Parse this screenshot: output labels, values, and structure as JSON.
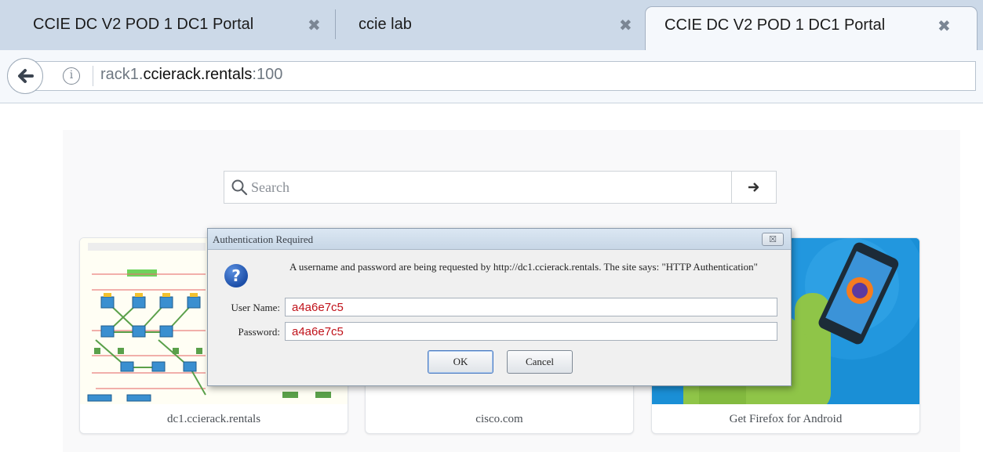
{
  "tabs": [
    {
      "label": "CCIE DC V2 POD 1 DC1 Portal",
      "close": "✖",
      "active": false
    },
    {
      "label": "ccie lab",
      "close": "✖",
      "active": false
    },
    {
      "label": "CCIE DC V2 POD 1 DC1 Portal",
      "close": "✖",
      "active": true
    }
  ],
  "navbar": {
    "back_icon": "arrow-left-icon",
    "info_icon": "info-icon",
    "info_glyph": "i",
    "url": {
      "subdomain": "rack1.",
      "host": "ccierack.rentals",
      "port": ":100"
    }
  },
  "search": {
    "placeholder": "Search",
    "search_icon": "search-icon",
    "go_icon": "arrow-right-icon"
  },
  "tiles": [
    {
      "label": "dc1.ccierack.rentals",
      "thumb": "network-topology-diagram"
    },
    {
      "label": "cisco.com",
      "thumb": "blank"
    },
    {
      "label": "Get Firefox for Android",
      "thumb": "firefox-android-phone-illustration"
    }
  ],
  "dialog": {
    "title": "Authentication Required",
    "close_glyph": "☒",
    "icon": "question-icon",
    "icon_glyph": "?",
    "message": "A username and password are being requested by http://dc1.ccierack.rentals. The site says: \"HTTP Authentication\"",
    "username_label": "User Name:",
    "username_value": "a4a6e7c5",
    "password_label": "Password:",
    "password_value": "a4a6e7c5",
    "ok_label": "OK",
    "cancel_label": "Cancel"
  },
  "colors": {
    "tabstrip": "#ccd9e8",
    "active_tab": "#f5f8fc",
    "field_value_red": "#c0121a",
    "firefox_tile_blue": "#1a8fd6",
    "android_green": "#8fc548"
  }
}
